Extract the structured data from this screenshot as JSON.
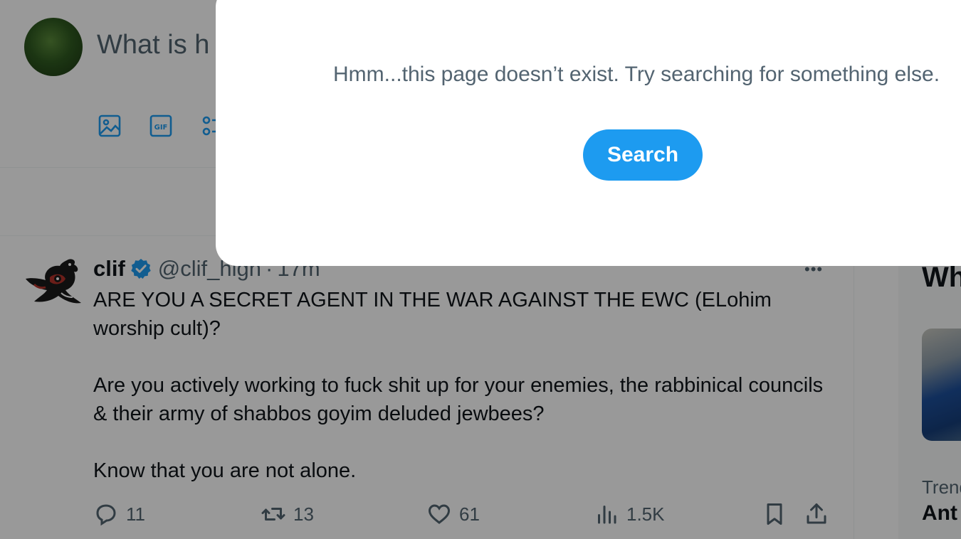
{
  "composer": {
    "placeholder": "What is h",
    "tools": [
      "image-icon",
      "gif-icon",
      "poll-icon"
    ]
  },
  "tweet": {
    "name": "clif",
    "handle": "@clif_high",
    "dot": "·",
    "time": "17m",
    "more": "•••",
    "text": [
      "ARE YOU A SECRET AGENT IN THE WAR AGAINST THE EWC (ELohim worship cult)?",
      "Are you actively working to fuck shit up for your enemies, the rabbinical councils & their army of shabbos goyim deluded jewbees?",
      "Know that you are not alone."
    ],
    "actions": {
      "replies": "11",
      "retweets": "13",
      "likes": "61",
      "views": "1.5K"
    }
  },
  "sidebar": {
    "heading": "Wh",
    "trend_category": "Trend",
    "trend_name": "Ant"
  },
  "modal": {
    "message": "Hmm...this page doesn’t exist. Try searching for something else.",
    "button": "Search"
  },
  "colors": {
    "accent": "#1d9bf0",
    "text_primary": "#0f1419",
    "text_secondary": "#536471"
  }
}
